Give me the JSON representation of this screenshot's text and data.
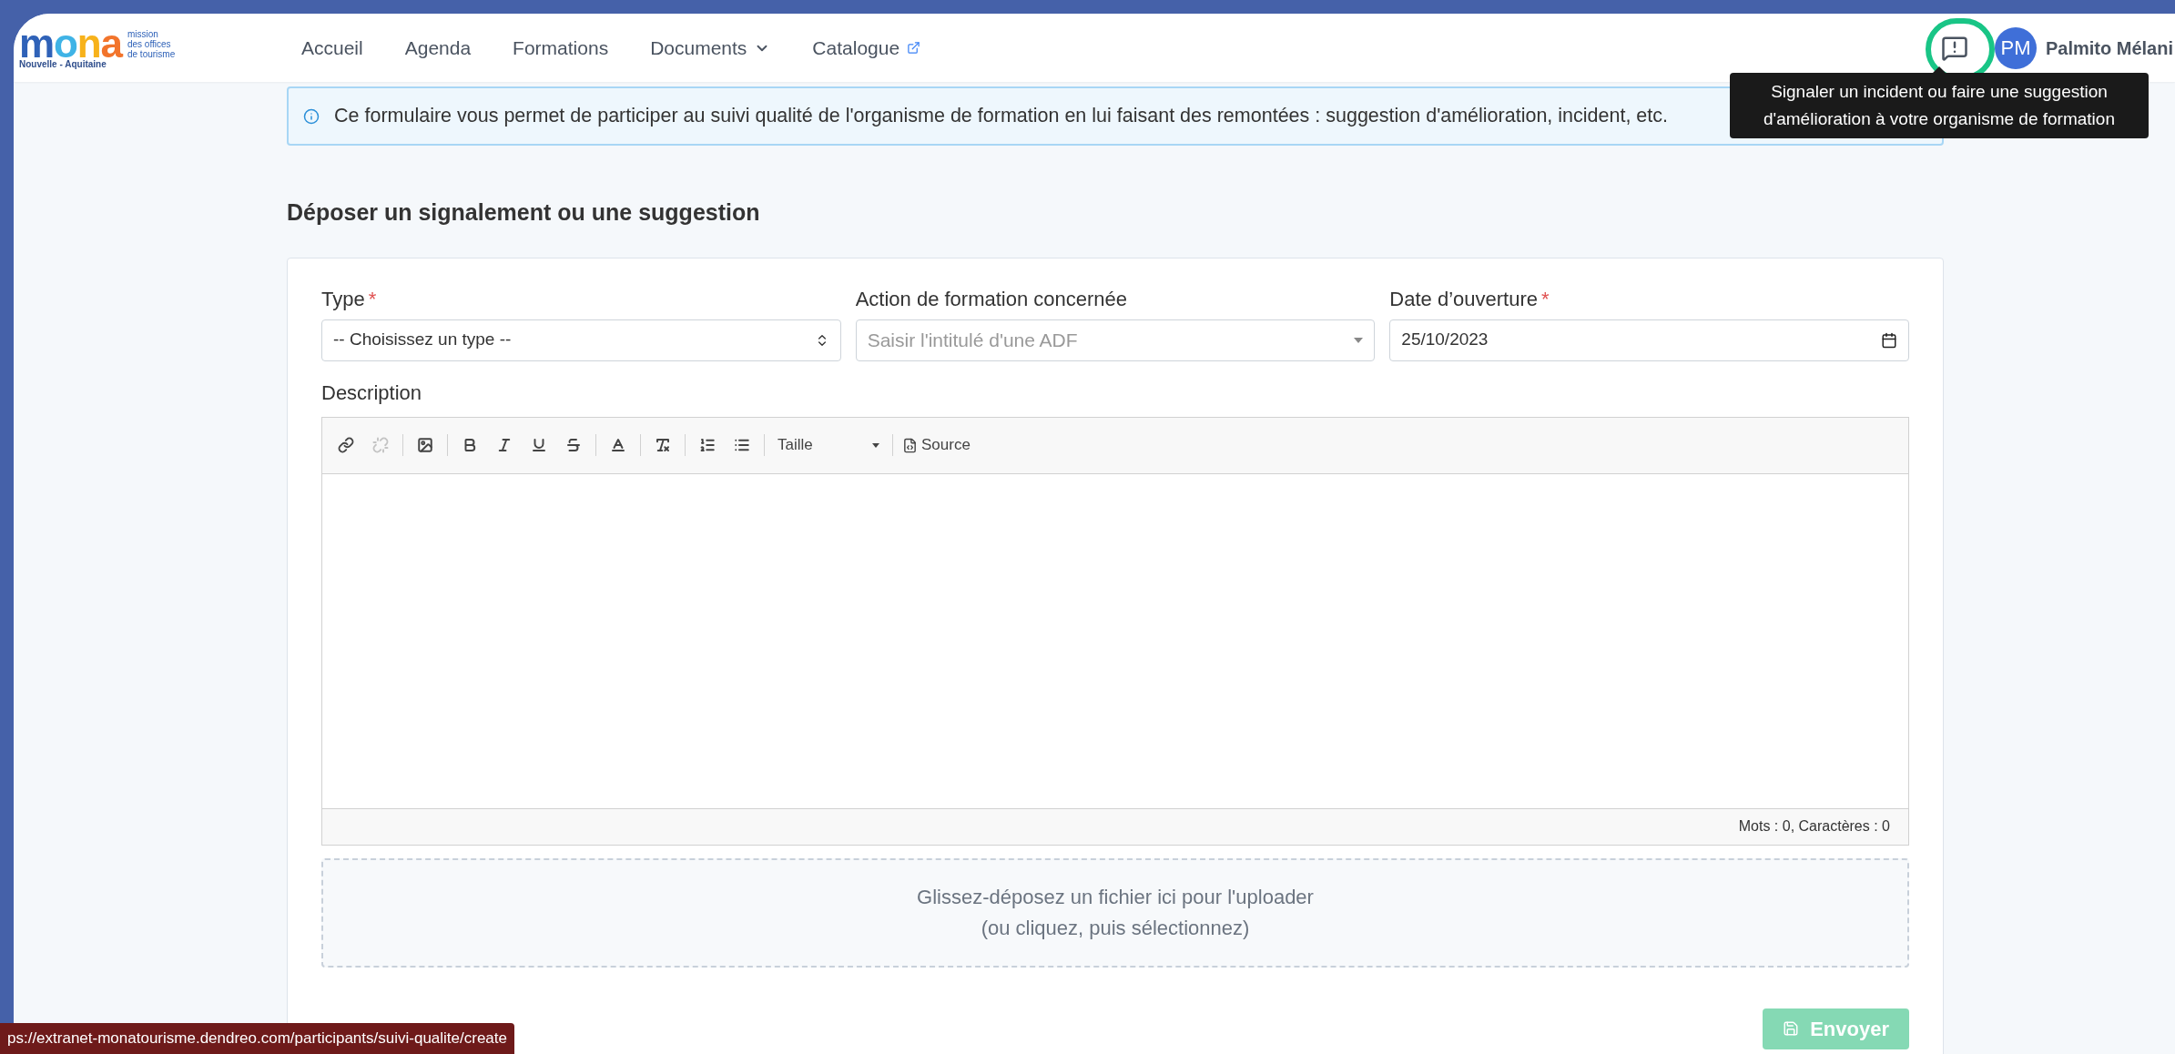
{
  "logo": {
    "wordmark": "mona",
    "tagline": [
      "mission",
      "des offices",
      "de tourisme"
    ],
    "region": "Nouvelle - Aquitaine"
  },
  "nav": [
    {
      "label": "Accueil",
      "kind": "link"
    },
    {
      "label": "Agenda",
      "kind": "link"
    },
    {
      "label": "Formations",
      "kind": "link"
    },
    {
      "label": "Documents",
      "kind": "dropdown"
    },
    {
      "label": "Catalogue",
      "kind": "external"
    }
  ],
  "user": {
    "initials": "PM",
    "name": "Palmito Mélani"
  },
  "tooltip": {
    "lines": [
      "Signaler un incident ou faire une suggestion",
      "d'amélioration à votre organisme de formation"
    ]
  },
  "info": "Ce formulaire vous permet de participer au suivi qualité de l'organisme de formation en lui faisant des remontées : suggestion d'amélioration, incident, etc.",
  "heading": "Déposer un signalement ou une suggestion",
  "fields": [
    {
      "label": "Type",
      "required_mark": "*",
      "kind": "select",
      "value": "-- Choisissez un type --"
    },
    {
      "label": "Action de formation concernée",
      "kind": "autocomplete",
      "placeholder": "Saisir l'intitulé d'une ADF"
    },
    {
      "label": "Date d’ouverture",
      "required_mark": "*",
      "kind": "date",
      "value": "25/10/2023"
    }
  ],
  "description": {
    "label": "Description",
    "toolbar_groups": [
      {
        "buttons": [
          {
            "kind": "link",
            "disabled": false
          },
          {
            "kind": "unlink",
            "disabled": true
          }
        ]
      },
      {
        "buttons": [
          {
            "kind": "image",
            "disabled": false
          }
        ]
      },
      {
        "buttons": [
          {
            "kind": "bold",
            "disabled": false
          },
          {
            "kind": "italic",
            "disabled": false
          },
          {
            "kind": "underline",
            "disabled": false
          },
          {
            "kind": "strike",
            "disabled": false
          }
        ]
      },
      {
        "buttons": [
          {
            "kind": "text-color",
            "disabled": false
          }
        ]
      },
      {
        "buttons": [
          {
            "kind": "clear-format",
            "disabled": false
          }
        ]
      },
      {
        "buttons": [
          {
            "kind": "ordered-list",
            "disabled": false
          },
          {
            "kind": "bullet-list",
            "disabled": false
          }
        ]
      }
    ],
    "size_select": "Taille",
    "source": "Source",
    "counter": "Mots : 0, Caractères : 0"
  },
  "dropzone": [
    "Glissez-déposez un fichier ici pour l'uploader",
    "(ou cliquez, puis sélectionnez)"
  ],
  "submit": {
    "label": "Envoyer",
    "disabled": true
  },
  "status_url": "ps://extranet-monatourisme.dendreo.com/participants/suivi-qualite/create"
}
